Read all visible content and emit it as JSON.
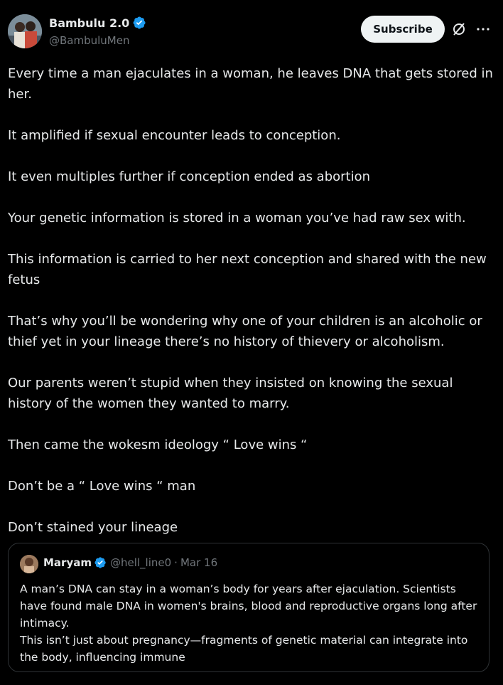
{
  "author": {
    "display_name": "Bambulu 2.0",
    "handle": "@BambuluMen",
    "verified": true,
    "verified_color": "#1d9bf0"
  },
  "actions": {
    "subscribe_label": "Subscribe",
    "grok_icon": "grok-icon",
    "more_icon": "more-icon"
  },
  "post": {
    "paragraphs": [
      "Every time a man ejaculates in a woman, he leaves DNA that gets stored in her.",
      "It amplified if sexual encounter leads to conception.",
      "It even multiples further if conception ended as abortion",
      "Your genetic information is stored in a woman you’ve had raw sex with.",
      "This information is carried to her next conception and shared with the new fetus",
      "That’s why you’ll be wondering why one of your children is an alcoholic or thief yet in your lineage there’s no history of thievery or alcoholism.",
      "Our parents weren’t stupid when they insisted on knowing the sexual history of the women they wanted to marry.",
      "Then came the wokesm ideology “ Love wins “",
      "Don’t be a “ Love wins “ man",
      "Don’t stained your lineage"
    ]
  },
  "quoted_post": {
    "display_name": "Maryam",
    "handle": "@hell_line0",
    "separator": "·",
    "date": "Mar 16",
    "verified": true,
    "lines": [
      "A man’s DNA can stay in a woman’s body for years after ejaculation. Scientists have found male DNA in women's brains, blood and reproductive organs long after intimacy.",
      "This isn’t just about pregnancy—fragments of genetic material can integrate into the body, influencing immune"
    ]
  },
  "colors": {
    "background": "#000000",
    "text": "#e7e9ea",
    "secondary_text": "#71767b",
    "border": "#2f3336",
    "subscribe_bg": "#eff3f4"
  }
}
